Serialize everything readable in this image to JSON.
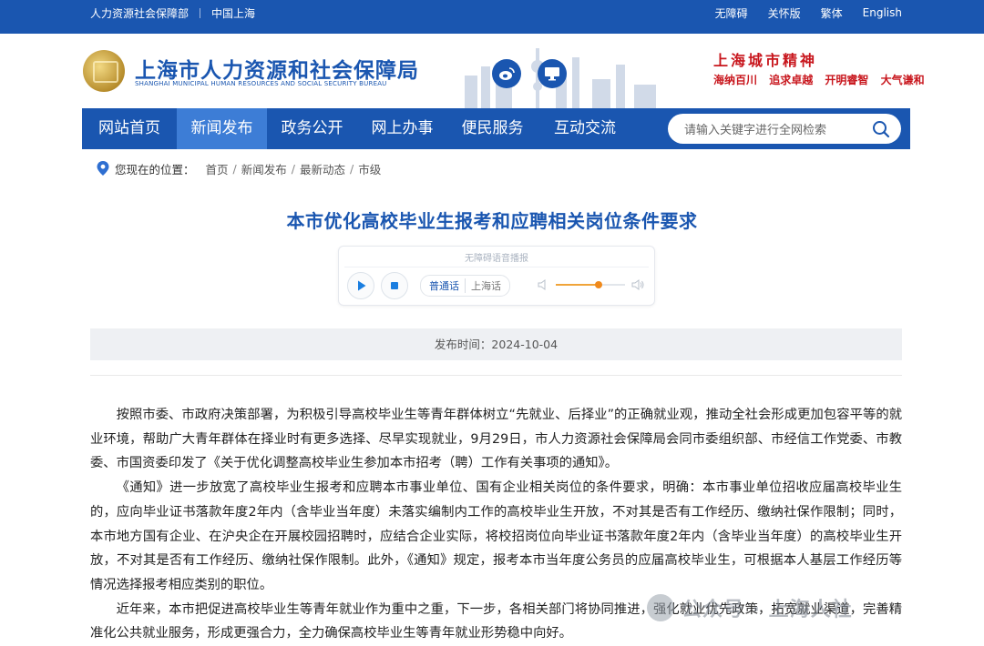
{
  "topbar": {
    "left_links": [
      "人力资源社会保障部",
      "中国上海"
    ],
    "right_links": [
      "无障碍",
      "关怀版",
      "繁体",
      "English"
    ]
  },
  "header": {
    "org_name_cn": "上海市人力资源和社会保障局",
    "org_name_en": "SHANGHAI MUNICIPAL HUMAN RESOURCES AND SOCIAL SECURITY BUREAU",
    "social_icons": [
      "weibo-icon",
      "monitor-icon"
    ],
    "spirit_title": "上海城市精神",
    "spirit_items": [
      "海纳百川",
      "追求卓越",
      "开明睿智",
      "大气谦和"
    ]
  },
  "nav": {
    "items": [
      "网站首页",
      "新闻发布",
      "政务公开",
      "网上办事",
      "便民服务",
      "互动交流"
    ],
    "active": "新闻发布",
    "search_placeholder": "请输入关键字进行全网检索"
  },
  "breadcrumb": {
    "label": "您现在的位置：",
    "items": [
      "首页",
      "新闻发布",
      "最新动态",
      "市级"
    ]
  },
  "article": {
    "title": "本市优化高校毕业生报考和应聘相关岗位条件要求",
    "player": {
      "label": "无障碍语音播报",
      "lang_active": "普通话",
      "lang_other": "上海话",
      "volume": 0.62
    },
    "publish_label": "发布时间：",
    "publish_date": "2024-10-04",
    "paragraphs": [
      "按照市委、市政府决策部署，为积极引导高校毕业生等青年群体树立“先就业、后择业”的正确就业观，推动全社会形成更加包容平等的就业环境，帮助广大青年群体在择业时有更多选择、尽早实现就业，9月29日，市人力资源社会保障局会同市委组织部、市经信工作党委、市教委、市国资委印发了《关于优化调整高校毕业生参加本市招考（聘）工作有关事项的通知》。",
      "《通知》进一步放宽了高校毕业生报考和应聘本市事业单位、国有企业相关岗位的条件要求，明确：本市事业单位招收应届高校毕业生的，应向毕业证书落款年度2年内（含毕业当年度）未落实编制内工作的高校毕业生开放，不对其是否有工作经历、缴纳社保作限制；同时，本市地方国有企业、在沪央企在开展校园招聘时，应结合企业实际，将校招岗位向毕业证书落款年度2年内（含毕业当年度）的高校毕业生开放，不对其是否有工作经历、缴纳社保作限制。此外，《通知》规定，报考本市当年度公务员的应届高校毕业生，可根据本人基层工作经历等情况选择报考相应类别的职位。",
      "近年来，本市把促进高校毕业生等青年就业作为重中之重，下一步，各相关部门将协同推进，强化就业优先政策，拓宽就业渠道，完善精准化公共就业服务，形成更强合力，全力确保高校毕业生等青年就业形势稳中向好。"
    ]
  },
  "watermark": {
    "text": "公众号 · 上海人社"
  }
}
